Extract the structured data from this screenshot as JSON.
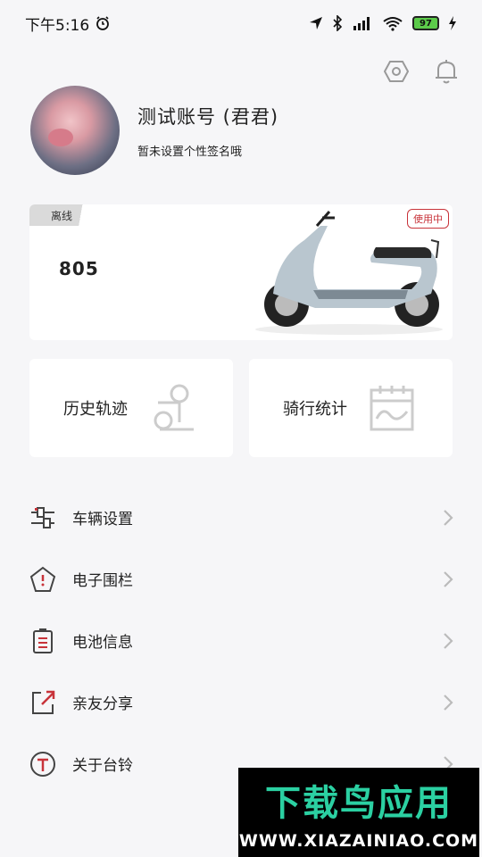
{
  "status_bar": {
    "time": "下午5:16",
    "battery": "97"
  },
  "profile": {
    "username": "测试账号 (君君)",
    "signature": "暂未设置个性签名哦"
  },
  "vehicle": {
    "status": "离线",
    "number": "805",
    "badge": "使用中"
  },
  "quick_actions": [
    {
      "label": "历史轨迹",
      "icon": "track-history-icon"
    },
    {
      "label": "骑行统计",
      "icon": "ride-stats-icon"
    }
  ],
  "menu": [
    {
      "label": "车辆设置",
      "icon": "vehicle-settings-icon"
    },
    {
      "label": "电子围栏",
      "icon": "geofence-icon"
    },
    {
      "label": "电池信息",
      "icon": "battery-info-icon"
    },
    {
      "label": "亲友分享",
      "icon": "share-icon"
    },
    {
      "label": "关于台铃",
      "icon": "about-icon"
    }
  ],
  "watermark": {
    "title": "下载鸟应用",
    "url": "WWW.XIAZAINIAO.COM"
  },
  "colors": {
    "accent": "#c8333a",
    "background": "#f6f6f8",
    "card": "#ffffff",
    "watermark_green": "#2bd0a2"
  }
}
